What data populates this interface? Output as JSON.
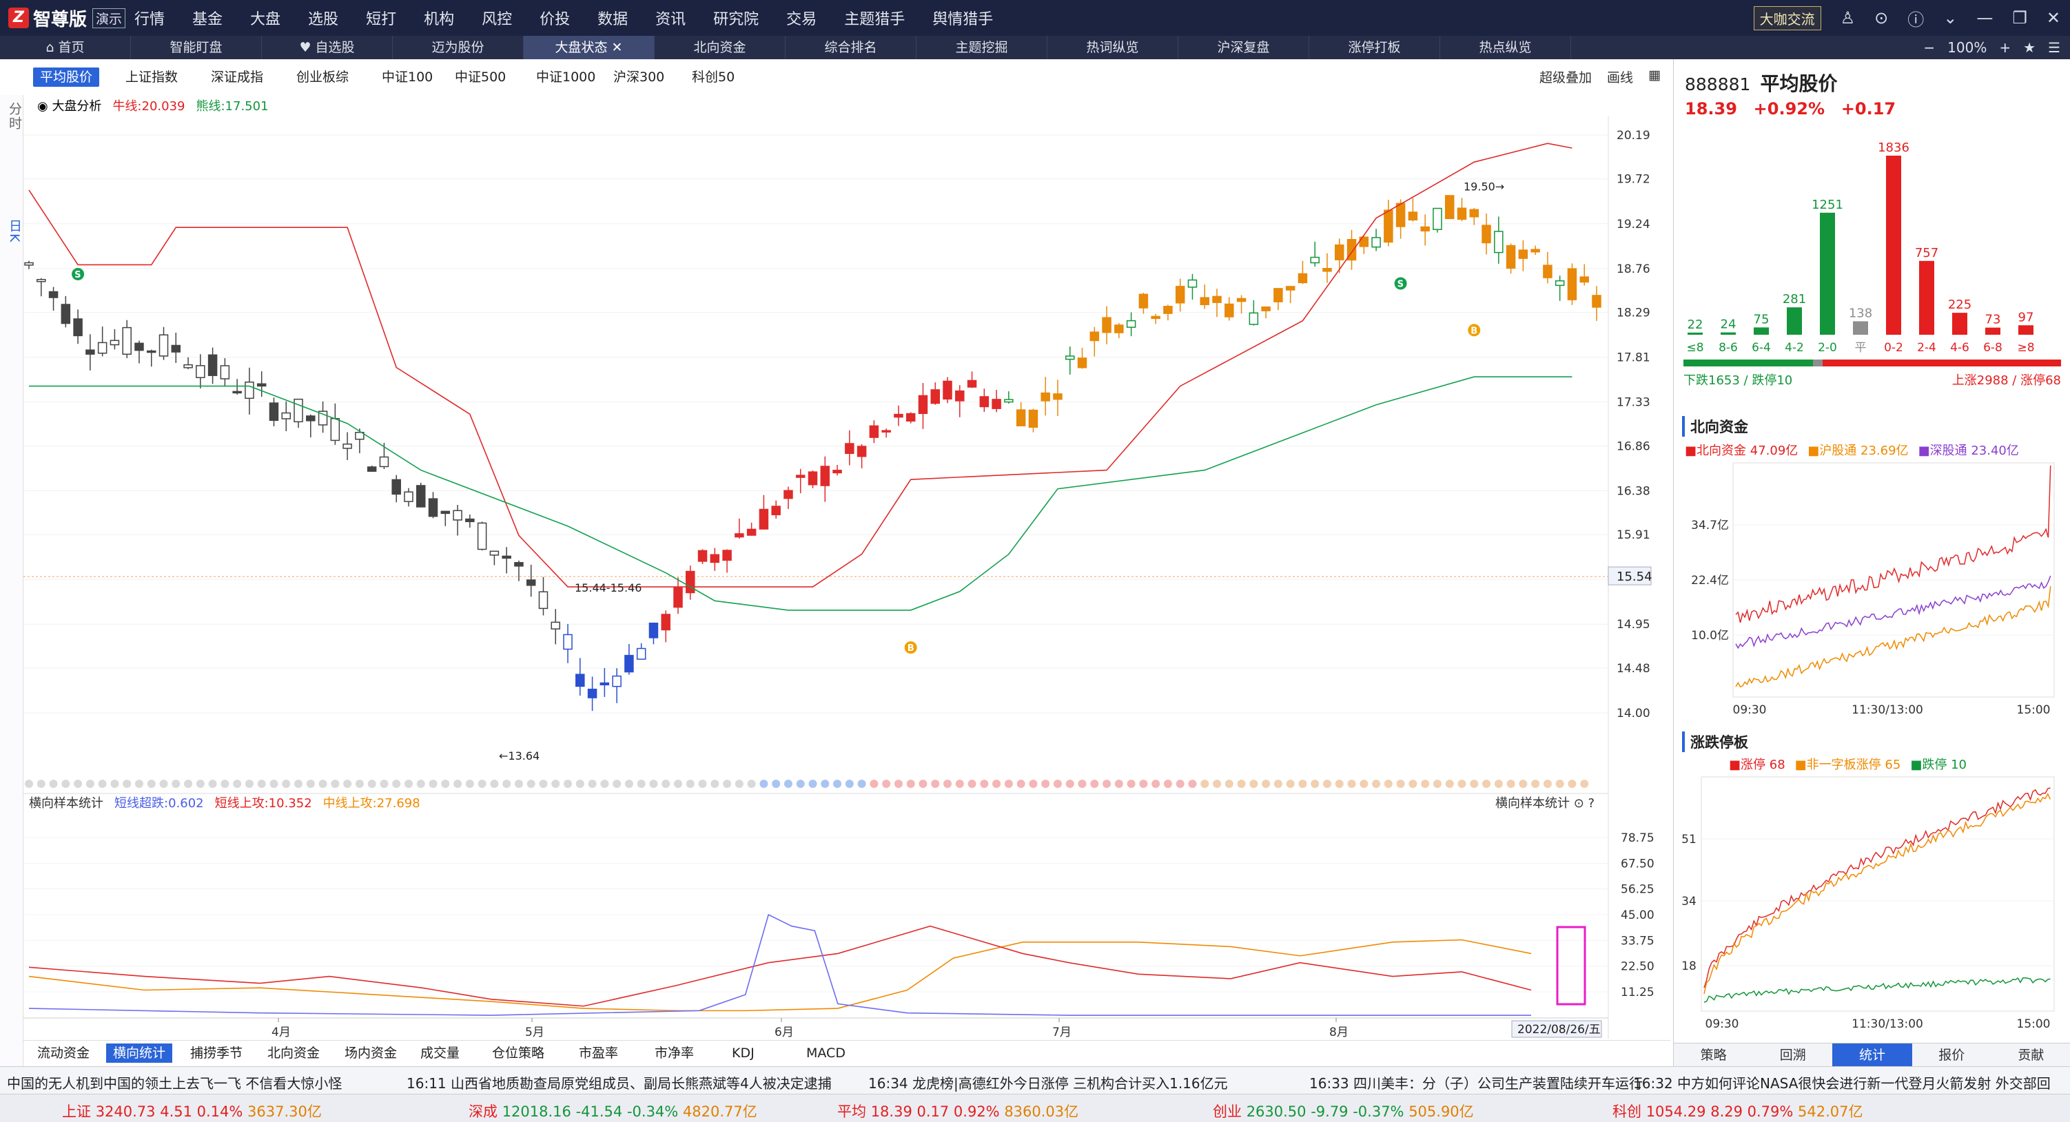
{
  "app": {
    "logo_text": "智尊版",
    "demo_badge": "演示",
    "main_menu": [
      "行情",
      "基金",
      "大盘",
      "选股",
      "短打",
      "机构",
      "风控",
      "价投",
      "数据",
      "资讯",
      "研究院",
      "交易",
      "主题猎手",
      "舆情猎手"
    ],
    "exchange_tag": "大咖交流"
  },
  "tabs": [
    {
      "label": "首页"
    },
    {
      "label": "智能盯盘"
    },
    {
      "label": "自选股"
    },
    {
      "label": "迈为股份"
    },
    {
      "label": "大盘状态"
    },
    {
      "label": "北向资金"
    },
    {
      "label": "综合排名"
    },
    {
      "label": "主题挖掘"
    },
    {
      "label": "热词纵览"
    },
    {
      "label": "沪深复盘"
    },
    {
      "label": "涨停打板"
    },
    {
      "label": "热点纵览"
    }
  ],
  "zoom": "100%",
  "subtabs": [
    "平均股价",
    "上证指数",
    "深证成指",
    "创业板综",
    "中证100",
    "中证500",
    "中证1000",
    "沪深300",
    "科创50"
  ],
  "subbar_right": [
    "超级叠加",
    "画线"
  ],
  "left_vertical": {
    "top": "分时",
    "mid": "日K"
  },
  "legend1": {
    "name": "大盘分析",
    "bull": "牛线:20.039",
    "bear": "熊线:17.501"
  },
  "legend2": {
    "name": "横向样本统计",
    "short_over": "短线超跌:0.602",
    "short_up": "短线上攻:10.352",
    "mid_up": "中线上攻:27.698"
  },
  "legend2_right": "横向样本统计",
  "chart_main": {
    "y_ticks": [
      "20.19",
      "19.72",
      "19.24",
      "18.76",
      "18.29",
      "17.81",
      "17.33",
      "16.86",
      "16.38",
      "15.91",
      "15.43",
      "14.95",
      "14.48",
      "14.00"
    ],
    "current_price_label": "15.54",
    "annotations": {
      "high": "19.50",
      "low": "13.64",
      "range": "15.44-15.46"
    },
    "x_labels": [
      "4月",
      "5月",
      "6月",
      "7月",
      "8月"
    ],
    "cursor_date": "2022/08/26/五"
  },
  "chart_sub": {
    "y_ticks": [
      "78.75",
      "67.50",
      "56.25",
      "45.00",
      "33.75",
      "22.50",
      "11.25"
    ]
  },
  "bottom_tabs": [
    "流动资金",
    "横向统计",
    "捕捞季节",
    "北向资金",
    "场内资金",
    "成交量",
    "仓位策略",
    "市盈率",
    "市净率",
    "KDJ",
    "MACD"
  ],
  "right": {
    "code": "888881",
    "name": "平均股价",
    "price": "18.39",
    "pct": "+0.92%",
    "chg": "+0.17",
    "dist": {
      "labels": [
        "≤8",
        "8-6",
        "6-4",
        "4-2",
        "2-0",
        "平",
        "0-2",
        "2-4",
        "4-6",
        "6-8",
        "≥8"
      ],
      "values": [
        22,
        24,
        75,
        281,
        1251,
        138,
        1836,
        757,
        225,
        73,
        97
      ],
      "down_text": "下跌1653 / 跌停10",
      "up_text": "上涨2988 / 涨停68"
    },
    "north": {
      "title": "北向资金",
      "legend": [
        {
          "label": "北向资金",
          "value": "47.09亿"
        },
        {
          "label": "沪股通",
          "value": "23.69亿"
        },
        {
          "label": "深股通",
          "value": "23.40亿"
        }
      ],
      "y_ticks": [
        "34.7亿",
        "22.4亿",
        "10.0亿"
      ],
      "x_ticks": [
        "09:30",
        "11:30/13:00",
        "15:00"
      ]
    },
    "limit": {
      "title": "涨跌停板",
      "legend": [
        {
          "label": "涨停",
          "value": "68"
        },
        {
          "label": "非一字板涨停",
          "value": "65"
        },
        {
          "label": "跌停",
          "value": "10"
        }
      ],
      "y_ticks": [
        "51",
        "34",
        "18"
      ],
      "x_ticks": [
        "09:30",
        "11:30/13:00",
        "15:00"
      ]
    },
    "tabs": [
      "策略",
      "回溯",
      "统计",
      "报价",
      "贡献"
    ]
  },
  "news": [
    "中国的无人机到中国的领土上去飞一飞 不信看大惊小怪",
    "16:11 山西省地质勘查局原党组成员、副局长熊燕斌等4人被决定逮捕",
    "16:34 龙虎榜|高德红外今日涨停 三机构合计买入1.16亿元",
    "16:33 四川美丰：分（子）公司生产装置陆续开车运行",
    "16:32 中方如何评论NASA很快会进行新一代登月火箭发射 外交部回"
  ],
  "indices": [
    {
      "name": "上证",
      "value": "3240.73",
      "chg": "4.51",
      "pct": "0.14%",
      "amt": "3637.30亿"
    },
    {
      "name": "深成",
      "value": "12018.16",
      "chg": "-41.54",
      "pct": "-0.34%",
      "amt": "4820.77亿"
    },
    {
      "name": "平均",
      "value": "18.39",
      "chg": "0.17",
      "pct": "0.92%",
      "amt": "8360.03亿"
    },
    {
      "name": "创业",
      "value": "2630.50",
      "chg": "-9.79",
      "pct": "-0.37%",
      "amt": "505.90亿"
    },
    {
      "name": "科创",
      "value": "1054.29",
      "chg": "8.29",
      "pct": "0.79%",
      "amt": "542.07亿"
    }
  ]
}
